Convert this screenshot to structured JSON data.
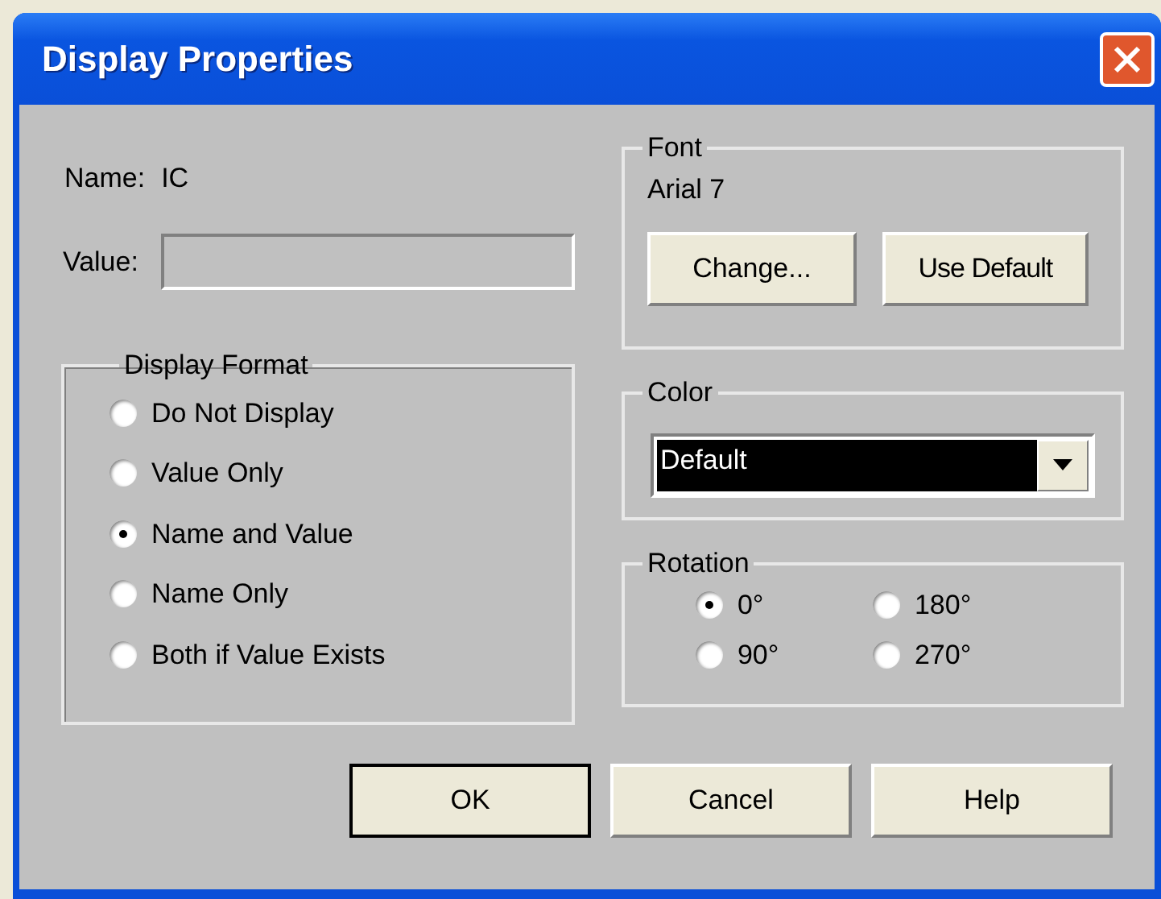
{
  "window": {
    "title": "Display Properties"
  },
  "name_field": {
    "label": "Name:",
    "value": "IC"
  },
  "value_field": {
    "label": "Value:",
    "disabled": true
  },
  "display_format": {
    "title": "Display Format",
    "options": [
      {
        "label": "Do Not Display",
        "selected": false
      },
      {
        "label": "Value Only",
        "selected": false
      },
      {
        "label": "Name and Value",
        "selected": true
      },
      {
        "label": "Name Only",
        "selected": false
      },
      {
        "label": "Both if Value Exists",
        "selected": false
      }
    ]
  },
  "font": {
    "title": "Font",
    "current": "Arial 7",
    "buttons": [
      "Change...",
      "Use Default"
    ]
  },
  "color": {
    "title": "Color",
    "value": "Default"
  },
  "rotation": {
    "title": "Rotation",
    "options": [
      {
        "label": "0°",
        "selected": true
      },
      {
        "label": "180°",
        "selected": false
      },
      {
        "label": "90°",
        "selected": false
      },
      {
        "label": "270°",
        "selected": false
      }
    ]
  },
  "buttons": [
    {
      "label": "OK",
      "default": true
    },
    {
      "label": "Cancel",
      "default": false
    },
    {
      "label": "Help",
      "default": false
    }
  ]
}
